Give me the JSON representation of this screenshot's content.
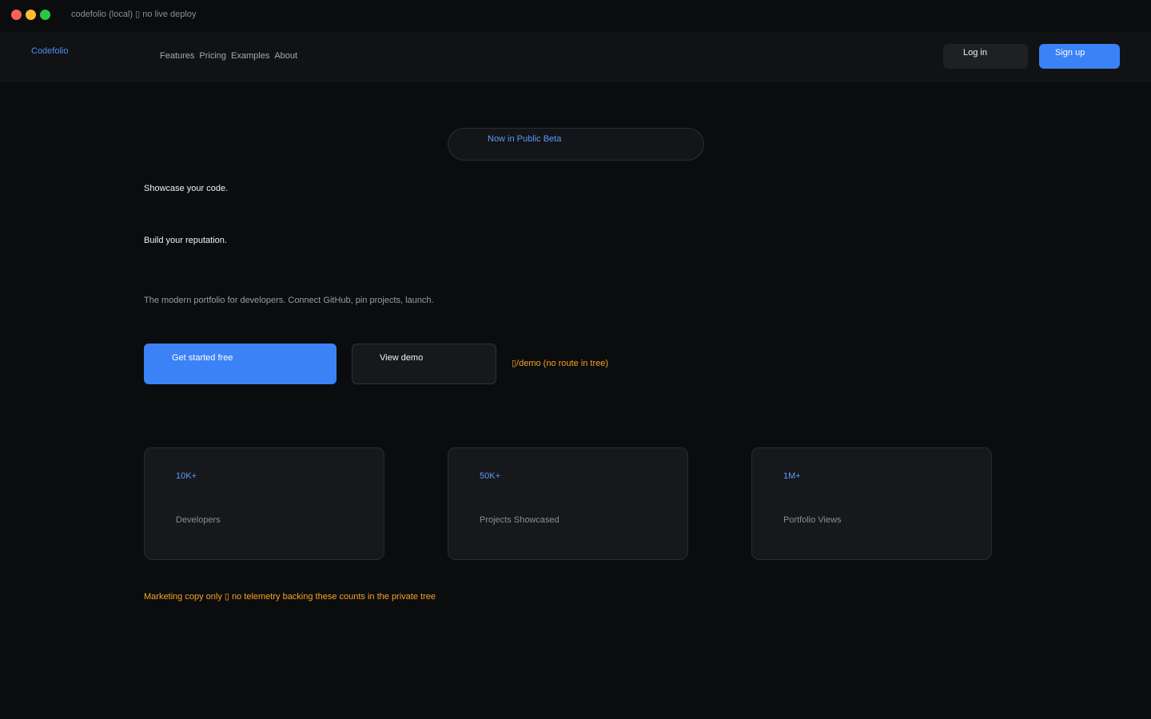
{
  "window": {
    "title": "codefolio (local) ▯ no live deploy",
    "colors": {
      "close": "#ff5f57",
      "minimize": "#febc2e",
      "maximize": "#28c840"
    }
  },
  "navbar": {
    "brand": "Codefolio",
    "links": [
      "Features",
      "Pricing",
      "Examples",
      "About"
    ],
    "login_label": "Log in",
    "signup_label": "Sign up"
  },
  "hero": {
    "badge": "Now in Public Beta",
    "headline_line1": "Showcase your code.",
    "headline_line2": "Build your reputation.",
    "subheadline": "The modern portfolio for developers. Connect GitHub, pin projects, launch.",
    "primary_cta": "Get started free",
    "secondary_cta": "View demo",
    "demo_note": "▯/demo (no route in tree)"
  },
  "stats": [
    {
      "value": "10K+",
      "label": "Developers"
    },
    {
      "value": "50K+",
      "label": "Projects Showcased"
    },
    {
      "value": "1M+",
      "label": "Portfolio Views"
    }
  ],
  "footer_note": "Marketing copy only ▯ no telemetry backing these counts in the private tree",
  "colors": {
    "background": "#0b0c0e",
    "accent": "#3b82f6",
    "warning": "#f5a524"
  }
}
